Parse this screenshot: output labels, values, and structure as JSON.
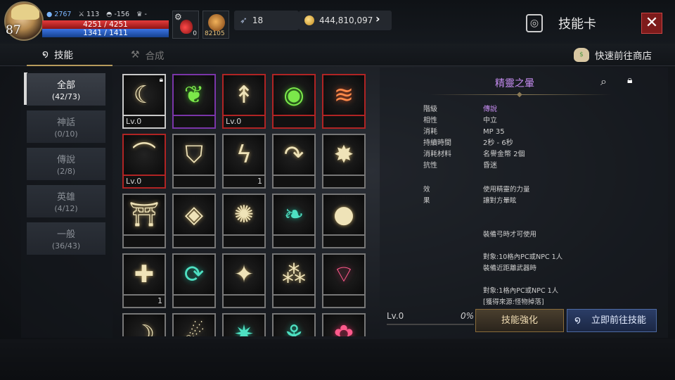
{
  "player": {
    "level": "87",
    "stat_a": "2767",
    "stat_b": "113",
    "stat_c": "-156",
    "stat_d": "-",
    "hp": "4251 / 4251",
    "mp": "1341 / 1411"
  },
  "quick_items": [
    {
      "name": "hp-potion",
      "count": "0"
    },
    {
      "name": "scroll",
      "count": "82105"
    }
  ],
  "currency": {
    "wings": "18",
    "gold": "444,810,097"
  },
  "header": {
    "title": "技能卡"
  },
  "tabs": [
    {
      "label": "技能",
      "active": true
    },
    {
      "label": "合成",
      "active": false
    }
  ],
  "shop_link": "快速前往商店",
  "categories": [
    {
      "label": "全部",
      "count": "(42/73)",
      "active": true
    },
    {
      "label": "神話",
      "count": "(0/10)",
      "active": false
    },
    {
      "label": "傳說",
      "count": "(2/8)",
      "active": false
    },
    {
      "label": "英雄",
      "count": "(4/12)",
      "active": false
    },
    {
      "label": "一般",
      "count": "(36/43)",
      "active": false
    }
  ],
  "skills": [
    {
      "icon": "moon-star-icon",
      "level": "Lv.0",
      "count": "",
      "rarity": "selected",
      "color": "gold",
      "locked": true
    },
    {
      "icon": "plant-icon",
      "level": "",
      "count": "",
      "rarity": "purple",
      "color": "green",
      "locked": false
    },
    {
      "icon": "spear-icon",
      "level": "Lv.0",
      "count": "",
      "rarity": "red",
      "color": "gold",
      "locked": false
    },
    {
      "icon": "beacon-icon",
      "level": "",
      "count": "",
      "rarity": "red",
      "color": "green",
      "locked": false
    },
    {
      "icon": "claw-icon",
      "level": "",
      "count": "",
      "rarity": "red",
      "color": "orange",
      "locked": false
    },
    {
      "icon": "wing-icon",
      "level": "Lv.0",
      "count": "",
      "rarity": "red",
      "color": "gold",
      "locked": false
    },
    {
      "icon": "shield-icon",
      "level": "",
      "count": "",
      "rarity": "normal",
      "color": "gold",
      "locked": false
    },
    {
      "icon": "lightning-icon",
      "level": "",
      "count": "1",
      "rarity": "normal",
      "color": "gold",
      "locked": false
    },
    {
      "icon": "curve-arrow-icon",
      "level": "",
      "count": "",
      "rarity": "normal",
      "color": "gold",
      "locked": false
    },
    {
      "icon": "burst-icon",
      "level": "",
      "count": "",
      "rarity": "normal",
      "color": "gold",
      "locked": false
    },
    {
      "icon": "altar-icon",
      "level": "",
      "count": "",
      "rarity": "normal",
      "color": "gold",
      "locked": false
    },
    {
      "icon": "eye-icon",
      "level": "",
      "count": "",
      "rarity": "normal",
      "color": "gold",
      "locked": false
    },
    {
      "icon": "gear-face-icon",
      "level": "",
      "count": "",
      "rarity": "normal",
      "color": "gold",
      "locked": false
    },
    {
      "icon": "leaf-icon",
      "level": "",
      "count": "",
      "rarity": "normal",
      "color": "teal",
      "locked": false
    },
    {
      "icon": "orb-icon",
      "level": "",
      "count": "",
      "rarity": "normal",
      "color": "gold",
      "locked": false
    },
    {
      "icon": "totem-icon",
      "level": "",
      "count": "1",
      "rarity": "normal",
      "color": "gold",
      "locked": false
    },
    {
      "icon": "cycle-icon",
      "level": "",
      "count": "",
      "rarity": "normal",
      "color": "teal",
      "locked": false
    },
    {
      "icon": "sparkle-icon",
      "level": "",
      "count": "",
      "rarity": "normal",
      "color": "gold",
      "locked": false
    },
    {
      "icon": "shatter-icon",
      "level": "",
      "count": "",
      "rarity": "normal",
      "color": "gold",
      "locked": false
    },
    {
      "icon": "bat-icon",
      "level": "",
      "count": "",
      "rarity": "normal",
      "color": "pink",
      "locked": false
    },
    {
      "icon": "crescent-icon",
      "level": "",
      "count": "",
      "rarity": "normal",
      "color": "gold",
      "locked": false
    },
    {
      "icon": "flame-icon",
      "level": "",
      "count": "",
      "rarity": "normal",
      "color": "gold",
      "locked": false
    },
    {
      "icon": "splash-icon",
      "level": "",
      "count": "",
      "rarity": "normal",
      "color": "teal",
      "locked": false
    },
    {
      "icon": "sprout-icon",
      "level": "",
      "count": "",
      "rarity": "normal",
      "color": "teal",
      "locked": false
    },
    {
      "icon": "cluster-icon",
      "level": "",
      "count": "",
      "rarity": "normal",
      "color": "pink",
      "locked": false
    }
  ],
  "detail": {
    "name": "精靈之暈",
    "properties": [
      {
        "key": "階級",
        "value": "傳說",
        "highlight": true
      },
      {
        "key": "相性",
        "value": "中立",
        "highlight": false
      },
      {
        "key": "消耗",
        "value": "MP 35",
        "highlight": false
      },
      {
        "key": "持續時間",
        "value": "2秒 - 6秒",
        "highlight": false
      },
      {
        "key": "消耗材料",
        "value": "名譽金幣 2個",
        "highlight": false
      },
      {
        "key": "抗性",
        "value": "昏迷",
        "highlight": false
      }
    ],
    "effect_label": "效果",
    "effect_lines": [
      "使用精靈的力量",
      "讓對方暈眩",
      "",
      "",
      "裝備弓時才可使用",
      "",
      "對象:10格內PC或NPC 1人",
      "裝備近距離武器時",
      "",
      "對象:1格內PC或NPC 1人",
      "[獲得來源:怪物掉落]"
    ],
    "level": "Lv.0",
    "progress": "0%",
    "enhance_label": "技能強化",
    "goto_label": "立即前往技能"
  },
  "colors": {
    "legend_purple": "#c58cf0",
    "hp_red": "#c02424",
    "mp_blue": "#2a5fbf",
    "gold_accent": "#b79b5c"
  }
}
